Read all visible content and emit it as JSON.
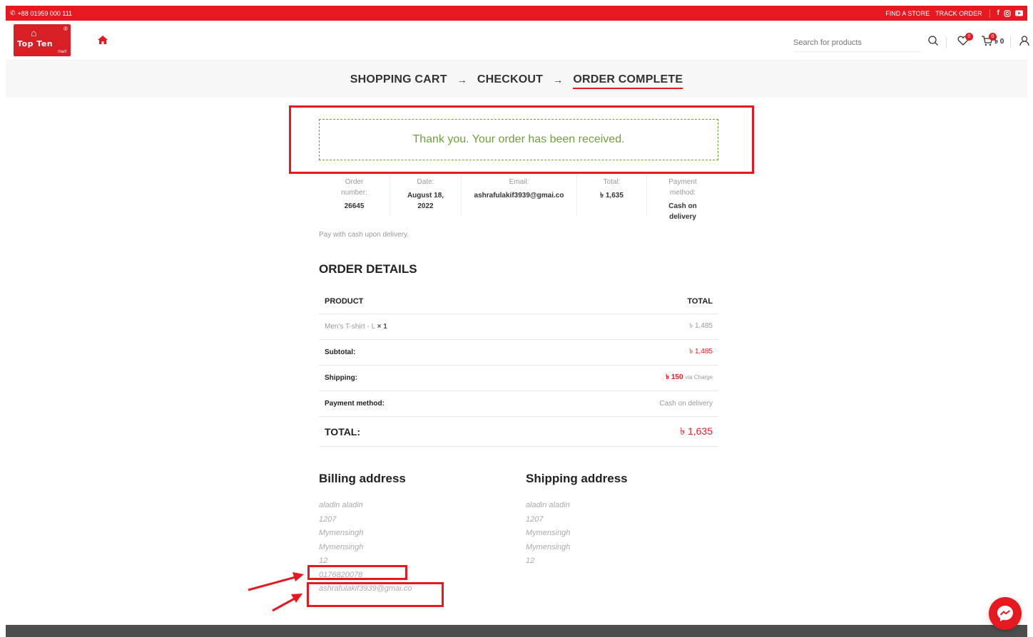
{
  "topbar": {
    "phone": "+88 01959 000 111",
    "links": [
      "FIND A STORE",
      "TRACK ORDER"
    ]
  },
  "header": {
    "logo_text": "Top Ten",
    "logo_sub": "mart",
    "search_placeholder": "Search for products",
    "wishlist_count": "0",
    "cart_count": "0",
    "cart_total": "৳ 0"
  },
  "steps": {
    "cart": "SHOPPING CART",
    "checkout": "CHECKOUT",
    "complete": "ORDER COMPLETE",
    "arrow": "→"
  },
  "thankyou": "Thank you. Your order has been received.",
  "overview": {
    "order_label_1": "Order",
    "order_label_2": "number:",
    "order_value": "26645",
    "date_label": "Date:",
    "date_value_1": "August 18,",
    "date_value_2": "2022",
    "email_label": "Email:",
    "email_value": "ashrafulakif3939@gmai.co",
    "total_label": "Total:",
    "total_value": "৳ 1,635",
    "payment_label_1": "Payment",
    "payment_label_2": "method:",
    "payment_value_1": "Cash on",
    "payment_value_2": "delivery"
  },
  "pay_note": "Pay with cash upon delivery.",
  "order_details": {
    "title": "ORDER DETAILS",
    "col_product": "PRODUCT",
    "col_total": "TOTAL",
    "item_name": "Men's T-shirt - L",
    "item_qty": "× 1",
    "item_total": "৳ 1,485",
    "subtotal_label": "Subtotal:",
    "subtotal_value": "৳ 1,485",
    "shipping_label": "Shipping:",
    "shipping_value": "৳ 150",
    "shipping_via": "via Charge",
    "payment_label": "Payment method:",
    "payment_value": "Cash on delivery",
    "total_label": "TOTAL:",
    "total_value": "৳ 1,635"
  },
  "billing": {
    "title": "Billing address",
    "lines": [
      "aladin aladin",
      "1207",
      "Mymensingh",
      "Mymensingh",
      "12",
      "0176820078",
      "ashrafulakif3939@gmai.co"
    ]
  },
  "shipping": {
    "title": "Shipping address",
    "lines": [
      "aladin aladin",
      "1207",
      "Mymensingh",
      "Mymensingh",
      "12"
    ]
  },
  "colors": {
    "brand_red": "#e5191f",
    "success_green": "#6fa13b",
    "footer_gray": "#4d4d4d"
  },
  "icons": [
    "phone-icon",
    "facebook-icon",
    "instagram-icon",
    "youtube-icon",
    "home-icon",
    "search-icon",
    "heart-icon",
    "cart-icon",
    "user-icon",
    "messenger-icon"
  ]
}
